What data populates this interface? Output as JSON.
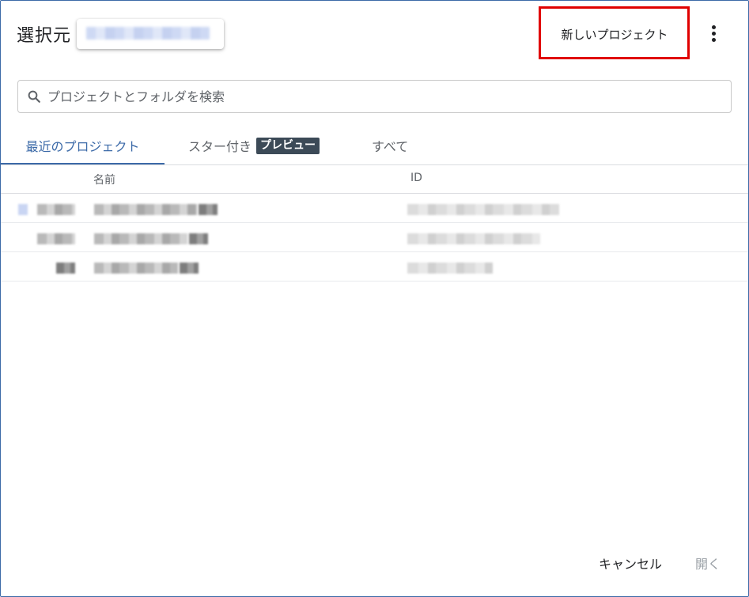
{
  "header": {
    "title": "選択元",
    "new_project_label": "新しいプロジェクト",
    "more_icon": "more-vert-icon",
    "highlight_color": "#e00000"
  },
  "search": {
    "placeholder": "プロジェクトとフォルダを検索",
    "icon": "search-icon"
  },
  "tabs": {
    "recent": "最近のプロジェクト",
    "starred": "スター付き",
    "starred_badge": "プレビュー",
    "all": "すべて"
  },
  "table": {
    "columns": [
      "名前",
      "ID"
    ]
  },
  "footer": {
    "cancel_label": "キャンセル",
    "open_label": "開く"
  },
  "colors": {
    "accent": "#3c6aa8",
    "badge_bg": "#3c4a57"
  }
}
